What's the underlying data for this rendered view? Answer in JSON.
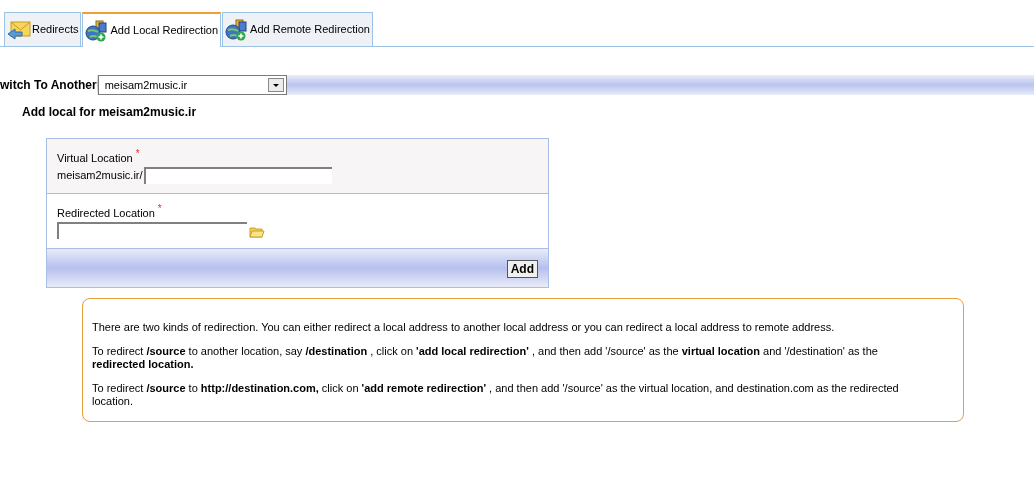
{
  "tabs": [
    {
      "label": "Redirects",
      "kind": "list",
      "selected": false
    },
    {
      "label": "Add Local Redirection",
      "kind": "add",
      "selected": true
    },
    {
      "label": "Add Remote Redirection",
      "kind": "add",
      "selected": false
    }
  ],
  "switcher": {
    "label": "witch To Another",
    "value": "meisam2music.ir"
  },
  "heading": "Add local for meisam2music.ir",
  "form": {
    "virtual": {
      "label": "Virtual Location",
      "required": "*",
      "prefix": "meisam2music.ir/"
    },
    "redirected": {
      "label": "Redirected Location",
      "required": "*"
    },
    "button": "Add"
  },
  "info": [
    "There are two kinds of redirection. You can either redirect a local address to another local address or you can redirect a local address to remote address.",
    "To redirect **/source** to another location, say **/destination** , click on **'add local redirection'** , and then add '/source' as the **virtual location** and '/destination' as the **redirected location.**",
    "To redirect **/source** to **http://destination.com,** click on **'add remote redirection'** , and then add '/source' as the virtual location, and destination.com as the redirected location."
  ]
}
